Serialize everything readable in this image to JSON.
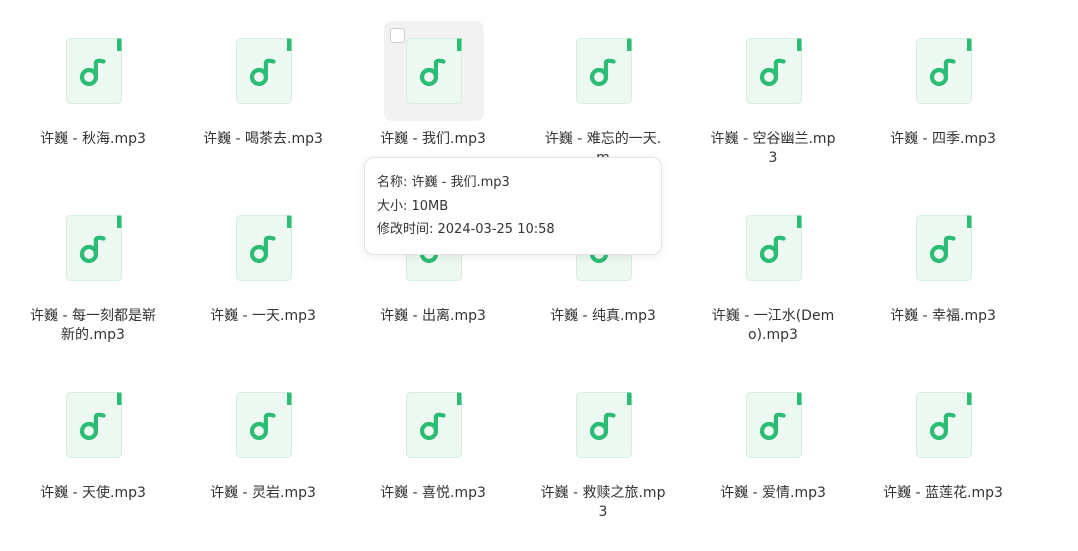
{
  "files": [
    {
      "name": "许巍 - 秋海.mp3"
    },
    {
      "name": "许巍 - 喝茶去.mp3"
    },
    {
      "name": "许巍 - 我们.mp3",
      "hovered": true
    },
    {
      "name": "许巍 - 难忘的一天.m"
    },
    {
      "name": "许巍 - 空谷幽兰.mp3"
    },
    {
      "name": "许巍 - 四季.mp3"
    },
    {
      "name": "许巍 - 每一刻都是崭新的.mp3"
    },
    {
      "name": "许巍 - 一天.mp3"
    },
    {
      "name": "许巍 - 出离.mp3"
    },
    {
      "name": "许巍 - 纯真.mp3"
    },
    {
      "name": "许巍 - 一江水(Demo).mp3"
    },
    {
      "name": "许巍 - 幸福.mp3"
    },
    {
      "name": "许巍 - 天使.mp3"
    },
    {
      "name": "许巍 - 灵岩.mp3"
    },
    {
      "name": "许巍 - 喜悦.mp3"
    },
    {
      "name": "许巍 - 救赎之旅.mp3"
    },
    {
      "name": "许巍 - 爱情.mp3"
    },
    {
      "name": "许巍 - 蓝莲花.mp3"
    }
  ],
  "tooltip": {
    "name_line": "名称: 许巍 - 我们.mp3",
    "size_line": "大小: 10MB",
    "mtime_line": "修改时间: 2024-03-25 10:58"
  },
  "icon": "music-file-icon",
  "colors": {
    "accent": "#2bbd73",
    "file_bg": "#eef8f2",
    "file_border": "#d5eedf",
    "hover_bg": "#f2f2f2"
  }
}
